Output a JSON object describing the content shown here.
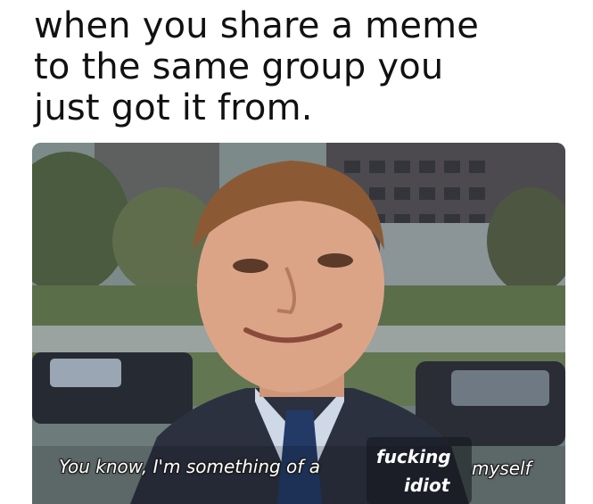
{
  "caption": {
    "lines": [
      "when you share a meme",
      "to the same group you",
      "just got it from."
    ]
  },
  "image": {
    "subtitle_main": "You know, I'm something of a",
    "subtitle_insert_line1": "fucking",
    "subtitle_insert_line2": "idiot",
    "subtitle_end": "myself"
  }
}
